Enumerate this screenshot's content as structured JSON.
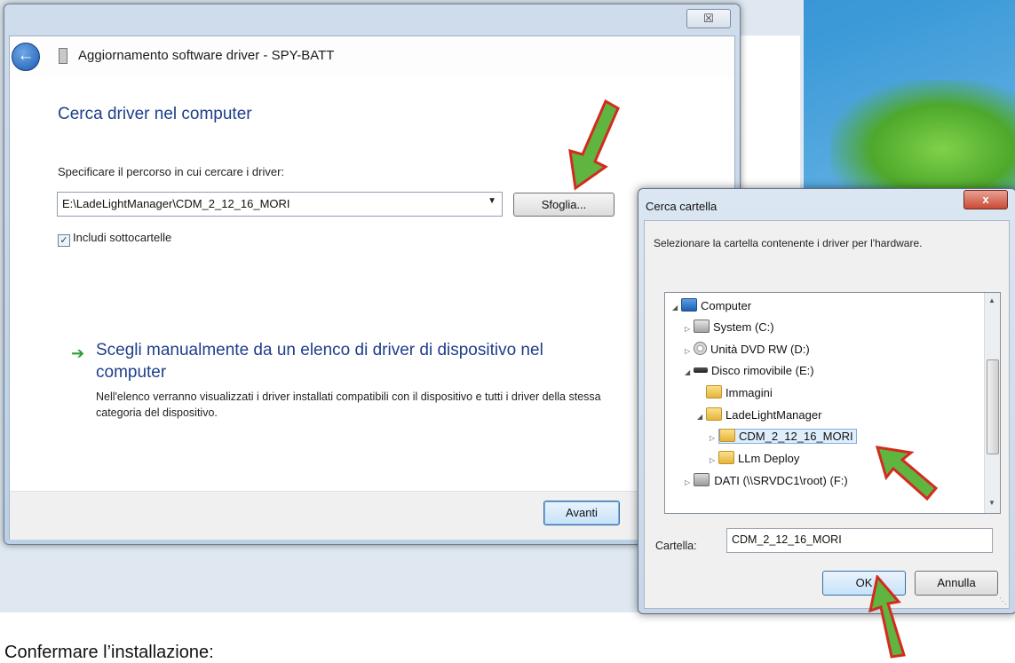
{
  "wizard": {
    "close_label": "☒",
    "title": "Aggiornamento software driver - SPY-BATT",
    "heading": "Cerca driver nel computer",
    "spec_label": "Specificare il percorso in cui cercare i driver:",
    "path_value": "E:\\LadeLightManager\\CDM_2_12_16_MORI",
    "browse_label": "Sfoglia...",
    "include_subfolders_label": "Includi sottocartelle",
    "include_subfolders_checked": true,
    "manual_title": "Scegli manualmente da un elenco di driver di dispositivo nel computer",
    "manual_desc": "Nell'elenco verranno visualizzati i driver installati compatibili con il dispositivo e tutti i driver della stessa categoria del dispositivo.",
    "next_label": "Avanti"
  },
  "folder_dialog": {
    "title": "Cerca cartella",
    "close_label": "x",
    "description": "Selezionare la cartella contenente i driver per l'hardware.",
    "tree": [
      {
        "label": "Computer",
        "icon": "computer-icon"
      },
      {
        "label": "System (C:)",
        "icon": "drive-icon"
      },
      {
        "label": "Unità DVD RW (D:)",
        "icon": "dvd-icon"
      },
      {
        "label": "Disco rimovibile (E:)",
        "icon": "removable-drive-icon"
      },
      {
        "label": "Immagini",
        "icon": "folder-icon"
      },
      {
        "label": "LadeLightManager",
        "icon": "folder-icon"
      },
      {
        "label": "CDM_2_12_16_MORI",
        "icon": "folder-icon",
        "selected": true
      },
      {
        "label": "LLm Deploy",
        "icon": "folder-icon"
      },
      {
        "label": "DATI (\\\\SRVDC1\\root) (F:)",
        "icon": "network-drive-icon"
      }
    ],
    "folder_label": "Cartella:",
    "folder_value": "CDM_2_12_16_MORI",
    "ok_label": "OK",
    "cancel_label": "Annulla"
  },
  "caption": "Confermare l’installazione:",
  "colors": {
    "annotation_arrow_fill": "#5fb53f",
    "annotation_arrow_stroke": "#d22b1f",
    "heading_blue": "#1e3f8a"
  }
}
